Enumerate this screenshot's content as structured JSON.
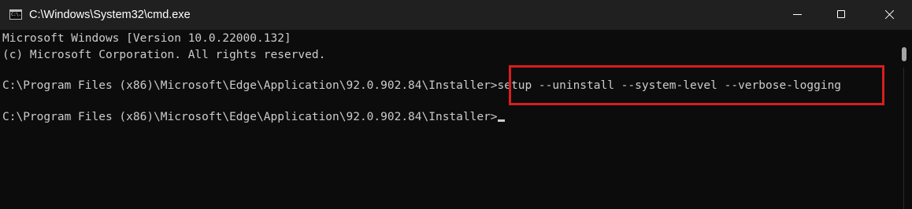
{
  "window": {
    "title": "C:\\Windows\\System32\\cmd.exe",
    "app_icon_glyph": "C:\\.",
    "app_icon_name": "cmd-icon",
    "controls": {
      "minimize_icon": "minimize-icon",
      "maximize_icon": "maximize-icon",
      "close_icon": "close-icon"
    }
  },
  "console": {
    "lines": [
      "Microsoft Windows [Version 10.0.22000.132]",
      "(c) Microsoft Corporation. All rights reserved.",
      "C:\\Program Files (x86)\\Microsoft\\Edge\\Application\\92.0.902.84\\Installer>setup --uninstall --system-level --verbose-logging",
      "C:\\Program Files (x86)\\Microsoft\\Edge\\Application\\92.0.902.84\\Installer>"
    ],
    "highlighted_command": "setup --uninstall --system-level --verbose-logging",
    "highlight_color": "#d81e1e",
    "text_color": "#cccccc",
    "background_color": "#0c0c0c"
  }
}
